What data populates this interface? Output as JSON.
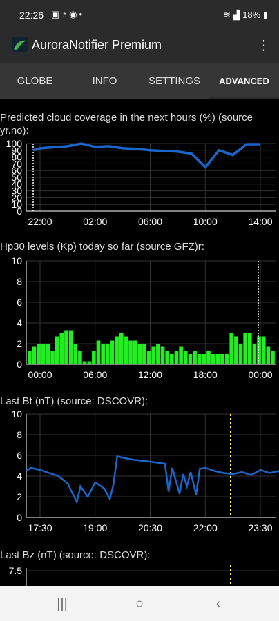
{
  "status_bar": {
    "time": "22:26",
    "battery": "18%"
  },
  "app_bar": {
    "title": "AuroraNotifier Premium"
  },
  "tabs": [
    {
      "label": "GLOBE"
    },
    {
      "label": "INFO"
    },
    {
      "label": "SETTINGS"
    },
    {
      "label": "ADVANCED",
      "active": true
    }
  ],
  "colors": {
    "cloud": "#1a66cc",
    "hp30": "#22ee22",
    "bt": "#1a66cc",
    "bz": "#1a66cc",
    "now_marker": "#ffff55",
    "grid": "#333333"
  },
  "chart_data": [
    {
      "type": "line",
      "title": "Predicted cloud coverage in the next hours (%) (source yr.no):",
      "ylim": [
        0,
        100
      ],
      "yticks": [
        0,
        10,
        20,
        30,
        40,
        50,
        60,
        70,
        80,
        90,
        100
      ],
      "xticks": [
        "22:00",
        "02:00",
        "06:00",
        "10:00",
        "14:00"
      ],
      "series": [
        {
          "values": [
            {
              "x": -0.5,
              "y": 90
            },
            {
              "x": 0,
              "y": 93
            },
            {
              "x": 2,
              "y": 96
            },
            {
              "x": 3,
              "y": 100
            },
            {
              "x": 4,
              "y": 95
            },
            {
              "x": 5,
              "y": 96
            },
            {
              "x": 6,
              "y": 93
            },
            {
              "x": 7,
              "y": 92
            },
            {
              "x": 8,
              "y": 90
            },
            {
              "x": 9,
              "y": 89
            },
            {
              "x": 10,
              "y": 88
            },
            {
              "x": 11,
              "y": 85
            },
            {
              "x": 12,
              "y": 65
            },
            {
              "x": 13,
              "y": 90
            },
            {
              "x": 14,
              "y": 83
            },
            {
              "x": 15,
              "y": 99
            },
            {
              "x": 16,
              "y": 99
            }
          ]
        }
      ]
    },
    {
      "type": "bar",
      "title": "Hp30 levels (Kp) today so far (source GFZ)r:",
      "ylim": [
        0,
        10
      ],
      "yticks": [
        0,
        2,
        4,
        6,
        8,
        10
      ],
      "xticks": [
        "00:00",
        "06:00",
        "12:00",
        "18:00",
        "00:00"
      ],
      "values": [
        1.3,
        1.7,
        2.0,
        2.0,
        2.0,
        1.3,
        2.7,
        3.0,
        3.3,
        3.3,
        2.0,
        1.3,
        0.3,
        0.3,
        1.3,
        2.3,
        2.0,
        2.0,
        2.3,
        2.7,
        3.0,
        2.7,
        2.3,
        2.3,
        2.0,
        2.0,
        1.3,
        1.7,
        2.0,
        1.7,
        1.3,
        1.0,
        1.3,
        1.7,
        1.3,
        1.0,
        1.3,
        1.0,
        1.0,
        1.3,
        1.0,
        1.0,
        1.0,
        1.0,
        3.0,
        2.7,
        2.0,
        3.0,
        3.0,
        2.0,
        2.7,
        2.7,
        1.7,
        1.3
      ]
    },
    {
      "type": "line",
      "title": "Last Bt (nT) (source: DSCOVR):",
      "ylim": [
        0,
        10
      ],
      "yticks": [
        0,
        2,
        4,
        6,
        8,
        10
      ],
      "xticks": [
        "17:30",
        "19:00",
        "20:30",
        "22:00",
        "23:30"
      ],
      "series": [
        {
          "values": [
            {
              "x": 17.0,
              "y": 4.5
            },
            {
              "x": 17.25,
              "y": 4.8
            },
            {
              "x": 17.5,
              "y": 4.6
            },
            {
              "x": 17.75,
              "y": 4.3
            },
            {
              "x": 18.0,
              "y": 4.0
            },
            {
              "x": 18.25,
              "y": 3.3
            },
            {
              "x": 18.5,
              "y": 1.5
            },
            {
              "x": 18.6,
              "y": 3.0
            },
            {
              "x": 18.8,
              "y": 2.0
            },
            {
              "x": 19.0,
              "y": 3.4
            },
            {
              "x": 19.25,
              "y": 2.8
            },
            {
              "x": 19.4,
              "y": 1.8
            },
            {
              "x": 19.5,
              "y": 3.2
            },
            {
              "x": 19.6,
              "y": 5.9
            },
            {
              "x": 20.0,
              "y": 5.6
            },
            {
              "x": 20.5,
              "y": 5.4
            },
            {
              "x": 20.9,
              "y": 5.2
            },
            {
              "x": 21.0,
              "y": 2.5
            },
            {
              "x": 21.1,
              "y": 4.8
            },
            {
              "x": 21.3,
              "y": 2.3
            },
            {
              "x": 21.4,
              "y": 4.2
            },
            {
              "x": 21.5,
              "y": 3.0
            },
            {
              "x": 21.6,
              "y": 4.4
            },
            {
              "x": 21.75,
              "y": 2.2
            },
            {
              "x": 21.85,
              "y": 4.7
            },
            {
              "x": 22.0,
              "y": 4.8
            },
            {
              "x": 22.25,
              "y": 4.5
            },
            {
              "x": 22.5,
              "y": 4.3
            },
            {
              "x": 22.75,
              "y": 4.2
            },
            {
              "x": 23.0,
              "y": 4.4
            },
            {
              "x": 23.25,
              "y": 4.1
            },
            {
              "x": 23.5,
              "y": 4.6
            },
            {
              "x": 23.75,
              "y": 4.3
            },
            {
              "x": 24.0,
              "y": 4.5
            },
            {
              "x": 24.1,
              "y": 4.1
            }
          ]
        }
      ]
    },
    {
      "type": "line",
      "title": "Last Bz (nT) (source: DSCOVR):",
      "yticks": [
        7.5
      ],
      "series": []
    }
  ]
}
